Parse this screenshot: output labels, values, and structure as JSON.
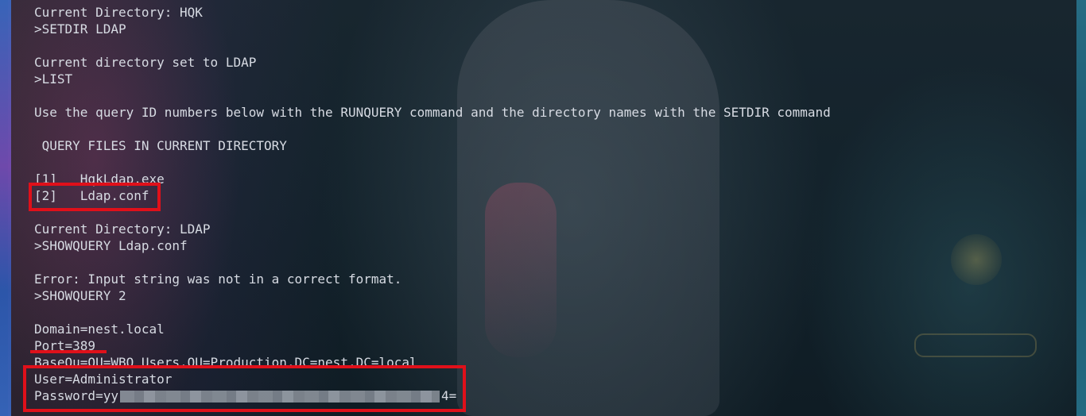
{
  "terminal": {
    "lines": [
      "Current Directory: HQK",
      ">SETDIR LDAP",
      "",
      "Current directory set to LDAP",
      ">LIST",
      "",
      "Use the query ID numbers below with the RUNQUERY command and the directory names with the SETDIR command",
      "",
      " QUERY FILES IN CURRENT DIRECTORY",
      "",
      "[1]   HqkLdap.exe",
      "[2]   Ldap.conf",
      "",
      "Current Directory: LDAP",
      ">SHOWQUERY Ldap.conf",
      "",
      "Error: Input string was not in a correct format.",
      ">SHOWQUERY 2",
      "",
      "Domain=nest.local",
      "Port=389",
      "BaseOu=OU=WBQ Users,OU=Production,DC=nest,DC=local",
      "User=Administrator"
    ],
    "password_prefix": "Password=yy",
    "password_suffix": "4="
  },
  "annotation_color": "#e0101a"
}
